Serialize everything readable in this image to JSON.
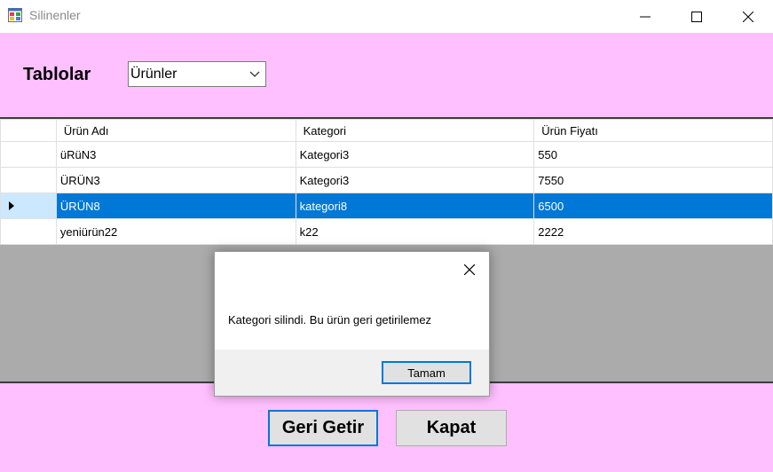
{
  "window": {
    "title": "Silinenler",
    "icon": "app-form-icon"
  },
  "toolbar": {
    "label": "Tablolar",
    "combo_value": "Ürünler"
  },
  "grid": {
    "columns": [
      "Ürün Adı",
      "Kategori",
      "Ürün Fiyatı"
    ],
    "rows": [
      [
        "üRüN3",
        "Kategori3",
        "550"
      ],
      [
        "ÜRÜN3",
        "Kategori3",
        "7550"
      ],
      [
        "ÜRÜN8",
        "kategori8",
        "6500"
      ],
      [
        "yeniürün22",
        "k22",
        "2222"
      ]
    ],
    "selected_row": 2
  },
  "buttons": {
    "restore": "Geri Getir",
    "close": "Kapat"
  },
  "dialog": {
    "message": "Kategori silindi. Bu ürün geri getirilemez",
    "ok": "Tamam"
  },
  "colors": {
    "background": "#ffc0ff",
    "selection": "#0078d7",
    "grid_bg": "#ababab"
  }
}
